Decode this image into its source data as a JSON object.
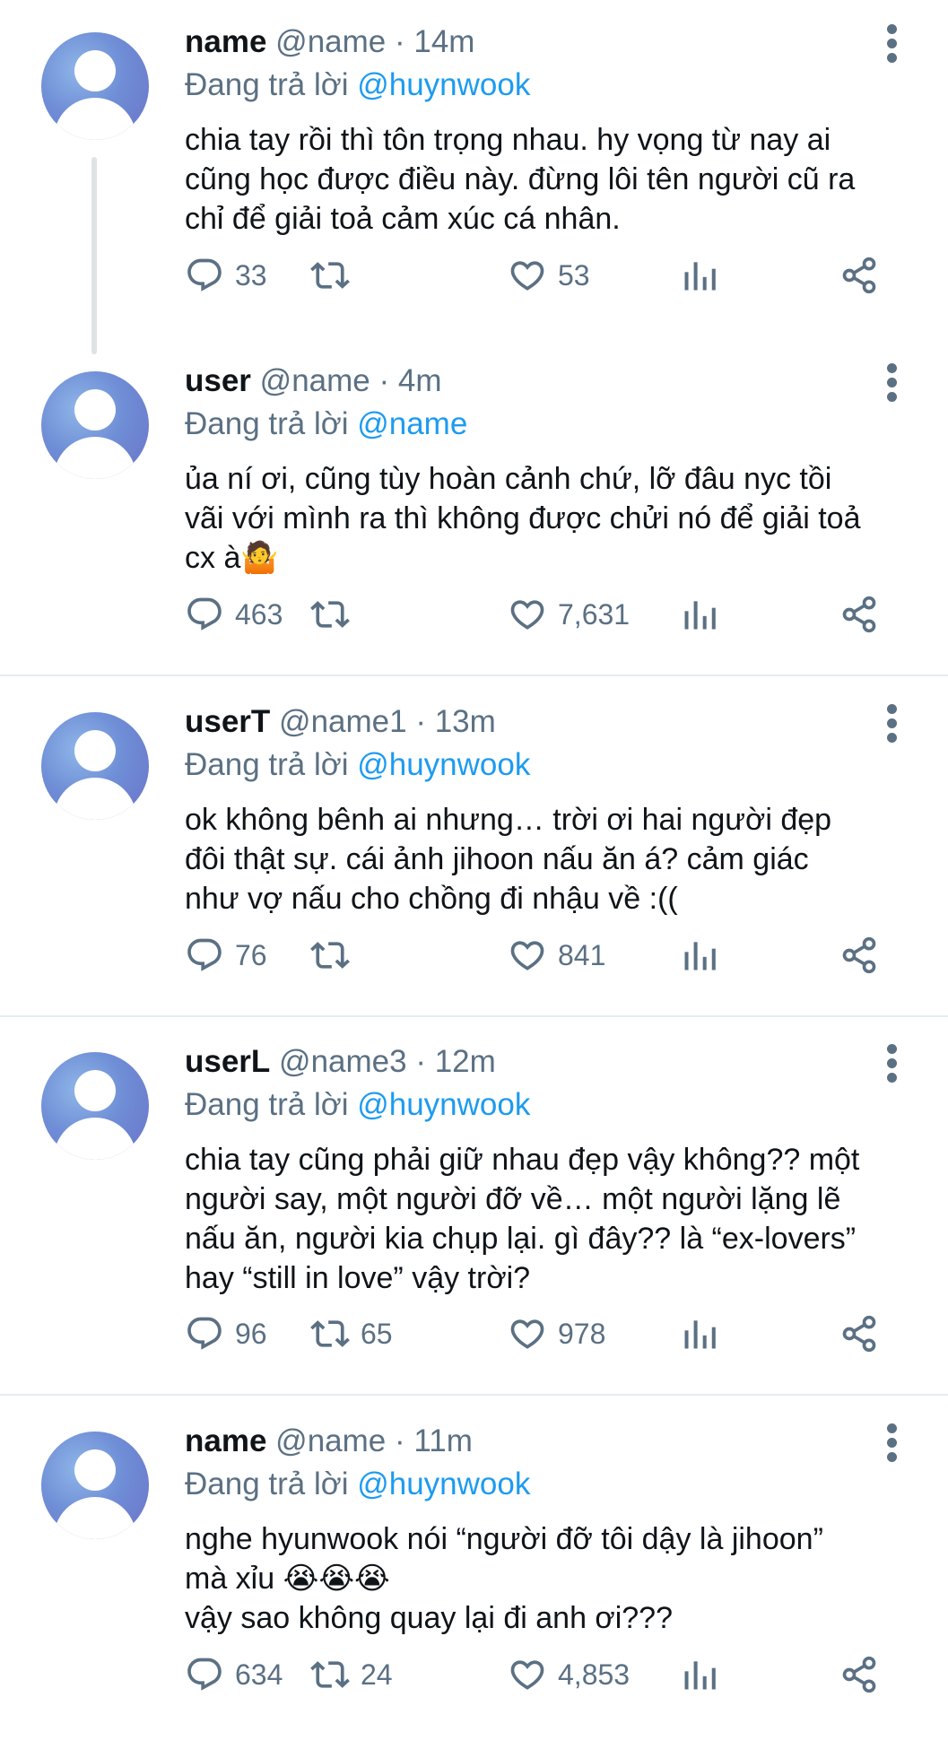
{
  "reply_prefix": "Đang trả lời",
  "tweets": [
    {
      "username": "name",
      "handle": "@name · 14m",
      "reply_to": "@huynwook",
      "text": "chia tay rồi thì tôn trọng nhau. hy vọng từ nay ai\ncũng học được điều này. đừng lôi tên người cũ ra\nchỉ để giải toả cảm xúc cá nhân.",
      "replies": "33",
      "retweets": "",
      "likes": "53"
    },
    {
      "username": "user",
      "handle": "@name · 4m",
      "reply_to": "@name",
      "text": "ủa ní ơi, cũng tùy hoàn cảnh chứ, lỡ đâu nyc tồi\nvãi với mình ra thì không được chửi nó để giải toả\ncx à🤷",
      "replies": "463",
      "retweets": "",
      "likes": "7,631"
    },
    {
      "username": "userT",
      "handle": "@name1 · 13m",
      "reply_to": "@huynwook",
      "text": "ok không bênh ai nhưng… trời ơi hai người đẹp\nđôi thật sự. cái ảnh jihoon nấu ăn á? cảm giác\nnhư vợ nấu cho chồng đi nhậu về :((",
      "replies": "76",
      "retweets": "",
      "likes": "841"
    },
    {
      "username": "userL",
      "handle": "@name3 · 12m",
      "reply_to": "@huynwook",
      "text": "chia tay cũng phải giữ nhau đẹp vậy không?? một\nngười say, một người đỡ về… một người lặng lẽ\nnấu ăn, người kia chụp lại. gì đây?? là “ex-lovers”\nhay “still in love” vậy trời?",
      "replies": "96",
      "retweets": "65",
      "likes": "978"
    },
    {
      "username": "name",
      "handle": "@name · 11m",
      "reply_to": "@huynwook",
      "text": "nghe hyunwook nói “người đỡ tôi dậy là jihoon”\nmà xỉu 😭😭😭\nvậy sao không quay lại đi anh ơi???",
      "replies": "634",
      "retweets": "24",
      "likes": "4,853"
    }
  ],
  "icons": {
    "reply": "reply-bubble-icon",
    "retweet": "retweet-icon",
    "like": "heart-icon",
    "views": "analytics-bars-icon",
    "share": "share-icon",
    "more": "more-vertical-icon"
  },
  "colors": {
    "mention": "#1d9bf0",
    "secondary_text": "#5b7083",
    "primary_text": "#0f1419",
    "divider": "#e6ecf0"
  }
}
